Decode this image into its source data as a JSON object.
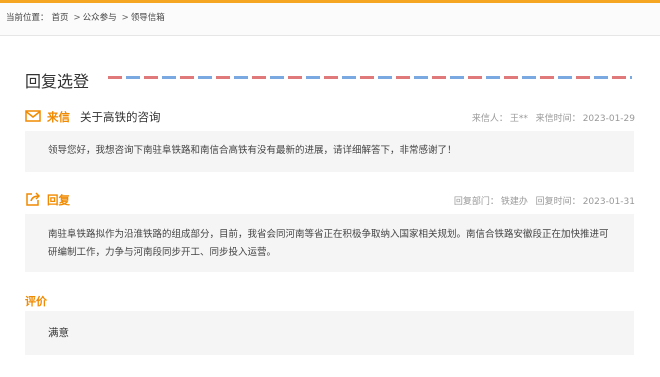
{
  "breadcrumb": {
    "prefix": "当前位置：",
    "items": [
      "首页",
      "公众参与",
      "领导信箱"
    ],
    "separator": ">"
  },
  "section": {
    "title": "回复选登"
  },
  "letter": {
    "label": "来信",
    "subject": "关于高铁的咨询",
    "sender_label": "来信人：",
    "sender": "王**",
    "time_label": "来信时间：",
    "time": "2023-01-29",
    "content": "领导您好，我想咨询下南驻阜铁路和南信合高铁有没有最新的进展，请详细解答下，非常感谢了！"
  },
  "reply": {
    "label": "回复",
    "dept_label": "回复部门：",
    "dept": "铁建办",
    "time_label": "回复时间：",
    "time": "2023-01-31",
    "content": "南驻阜铁路拟作为沿淮铁路的组成部分，目前，我省会同河南等省正在积极争取纳入国家相关规划。南信合铁路安徽段正在加快推进可研编制工作，力争与河南段同步开工、同步投入运营。"
  },
  "evaluation": {
    "label": "评价",
    "value": "满意"
  },
  "colors": {
    "accent": "#f08a00",
    "top_border": "#f5a623",
    "dash_red": "#e07a7a",
    "dash_blue": "#7aa8e0",
    "box_bg": "#f5f5f5"
  },
  "icons": {
    "letter": "envelope-icon",
    "reply": "reply-icon"
  }
}
